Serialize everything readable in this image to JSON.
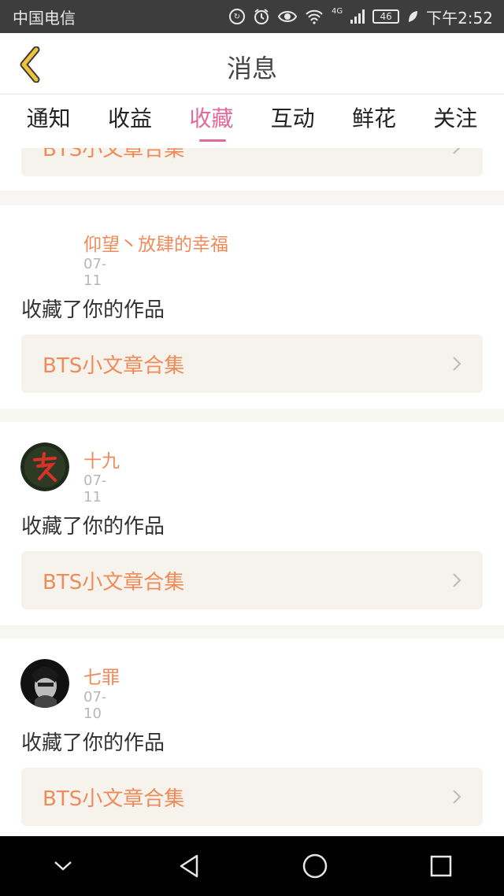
{
  "status_bar": {
    "carrier": "中国电信",
    "network": "4G",
    "battery": "46",
    "time": "下午2:52",
    "icons": [
      "hd-call-icon",
      "alarm-icon",
      "eye-icon",
      "wifi-icon",
      "signal-icon",
      "battery-icon",
      "leaf-icon"
    ]
  },
  "header": {
    "title": "消息",
    "back_icon": "chevron-left-icon",
    "back_color": "#f0c33c"
  },
  "tabs": [
    {
      "label": "通知",
      "active": false
    },
    {
      "label": "收益",
      "active": false
    },
    {
      "label": "收藏",
      "active": true
    },
    {
      "label": "互动",
      "active": false
    },
    {
      "label": "鲜花",
      "active": false
    },
    {
      "label": "关注",
      "active": false
    }
  ],
  "colors": {
    "accent": "#e06b98",
    "name": "#ef8b5a",
    "date": "#b7b7b7",
    "work_bg": "#f5f3ec"
  },
  "messages": [
    {
      "user": "",
      "date": "",
      "action": "",
      "work": "BTS小文章合集",
      "avatar": "none",
      "partial": true
    },
    {
      "user": "仰望丶放肆的幸福",
      "date": "07-11",
      "action": "收藏了你的作品",
      "work": "BTS小文章合集",
      "avatar": "blank"
    },
    {
      "user": "十九",
      "date": "07-11",
      "action": "收藏了你的作品",
      "work": "BTS小文章合集",
      "avatar": "red-calligraphy-avatar"
    },
    {
      "user": "七罪",
      "date": "07-10",
      "action": "收藏了你的作品",
      "work": "BTS小文章合集",
      "avatar": "bw-portrait-avatar"
    }
  ],
  "nav_bar": {
    "buttons": [
      "collapse-icon",
      "back-triangle-icon",
      "home-circle-icon",
      "recents-square-icon"
    ]
  }
}
